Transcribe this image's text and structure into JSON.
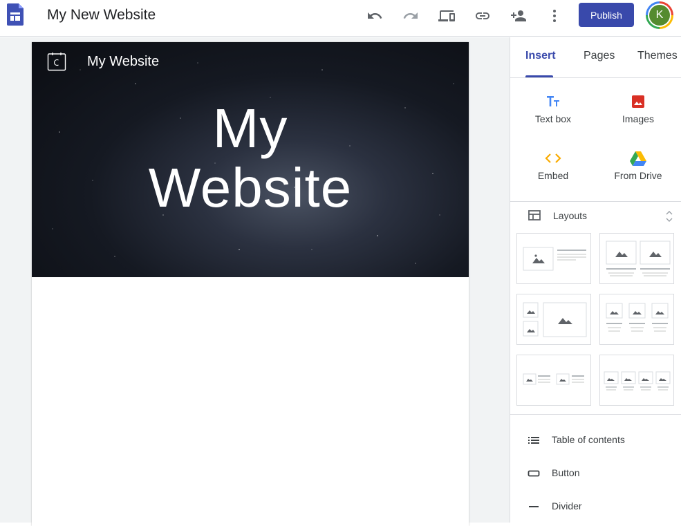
{
  "header": {
    "doc_title": "My New Website",
    "publish_label": "Publish",
    "avatar_letter": "K",
    "icons": [
      "undo-icon",
      "redo-icon",
      "preview-devices-icon",
      "link-icon",
      "share-person-add-icon",
      "more-vert-icon"
    ]
  },
  "page": {
    "site_name": "My Website",
    "hero_title_line1": "My",
    "hero_title_line2": "Website"
  },
  "panel": {
    "tabs": [
      "Insert",
      "Pages",
      "Themes"
    ],
    "active_tab": "Insert",
    "insert_items": [
      {
        "label": "Text box",
        "icon": "text-box-icon"
      },
      {
        "label": "Images",
        "icon": "image-icon"
      },
      {
        "label": "Embed",
        "icon": "embed-code-icon"
      },
      {
        "label": "From Drive",
        "icon": "google-drive-icon"
      }
    ],
    "layouts_label": "Layouts",
    "list_items": [
      {
        "label": "Table of contents",
        "icon": "list-icon"
      },
      {
        "label": "Button",
        "icon": "button-icon"
      },
      {
        "label": "Divider",
        "icon": "divider-icon"
      }
    ]
  },
  "colors": {
    "accent": "#3949ab",
    "publish_bg": "#3949ab",
    "avatar_bg": "#558b2f",
    "canvas_bg": "#f1f3f4"
  }
}
